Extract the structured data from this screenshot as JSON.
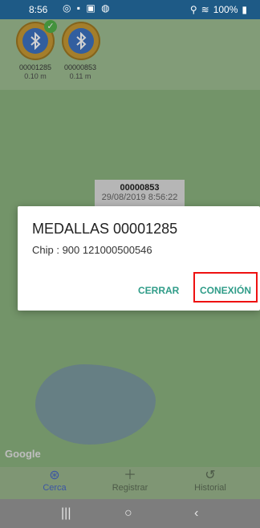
{
  "status": {
    "time": "8:56",
    "battery": "100%"
  },
  "devices": [
    {
      "id": "00001285",
      "distance": "0.10 m"
    },
    {
      "id": "00000853",
      "distance": "0.11 m"
    }
  ],
  "marker": {
    "id": "00000853",
    "date": "29/08/2019 8:56:22"
  },
  "map": {
    "google": "Google"
  },
  "dialog": {
    "title": "MEDALLAS 00001285",
    "chip": "Chip : 900 121000500546",
    "close": "CERRAR",
    "connect": "CONEXIÓN"
  },
  "nav": {
    "nearby": "Cerca",
    "register": "Registrar",
    "history": "Historial"
  },
  "colors": {
    "accent": "#2f9c88",
    "nav_active": "#4968c9",
    "status_bar": "#1e5a86"
  },
  "icons": [
    "bluetooth-icon",
    "check-icon",
    "plus-icon",
    "history-icon",
    "radar-icon"
  ]
}
